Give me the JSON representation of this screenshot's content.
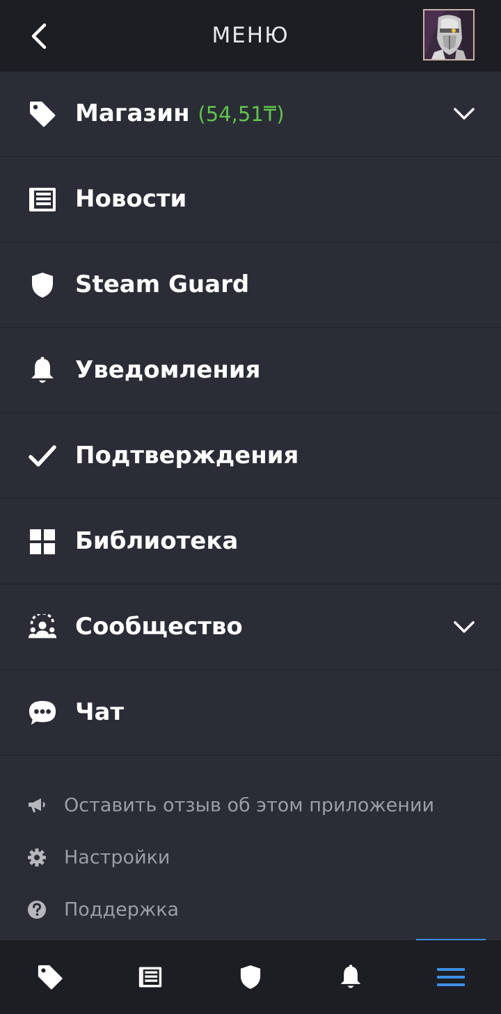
{
  "header": {
    "title": "МЕНЮ",
    "back_icon": "chevron-left-icon",
    "avatar_icon": "user-avatar"
  },
  "menu": {
    "items": [
      {
        "label": "Магазин",
        "balance": "(54,51₸)",
        "icon": "tag-icon",
        "expandable": true
      },
      {
        "label": "Новости",
        "icon": "news-icon",
        "expandable": false
      },
      {
        "label": "Steam Guard",
        "icon": "shield-icon",
        "expandable": false
      },
      {
        "label": "Уведомления",
        "icon": "bell-icon",
        "expandable": false
      },
      {
        "label": "Подтверждения",
        "icon": "check-icon",
        "expandable": false
      },
      {
        "label": "Библиотека",
        "icon": "grid-icon",
        "expandable": false
      },
      {
        "label": "Сообщество",
        "icon": "community-icon",
        "expandable": true
      },
      {
        "label": "Чат",
        "icon": "chat-icon",
        "expandable": false
      }
    ]
  },
  "secondary": {
    "items": [
      {
        "label": "Оставить отзыв об этом приложении",
        "icon": "megaphone-icon"
      },
      {
        "label": "Настройки",
        "icon": "gear-icon"
      },
      {
        "label": "Поддержка",
        "icon": "help-icon"
      }
    ]
  },
  "bottom_nav": {
    "tabs": [
      {
        "icon": "tag-icon",
        "active": false
      },
      {
        "icon": "news-icon",
        "active": false
      },
      {
        "icon": "shield-icon",
        "active": false
      },
      {
        "icon": "bell-icon",
        "active": false
      },
      {
        "icon": "menu-icon",
        "active": true
      }
    ]
  },
  "colors": {
    "background": "#2a2d36",
    "header": "#1d1e23",
    "balance": "#5fc54a",
    "secondary_text": "#9b9ea6",
    "accent": "#3d8fe6"
  }
}
